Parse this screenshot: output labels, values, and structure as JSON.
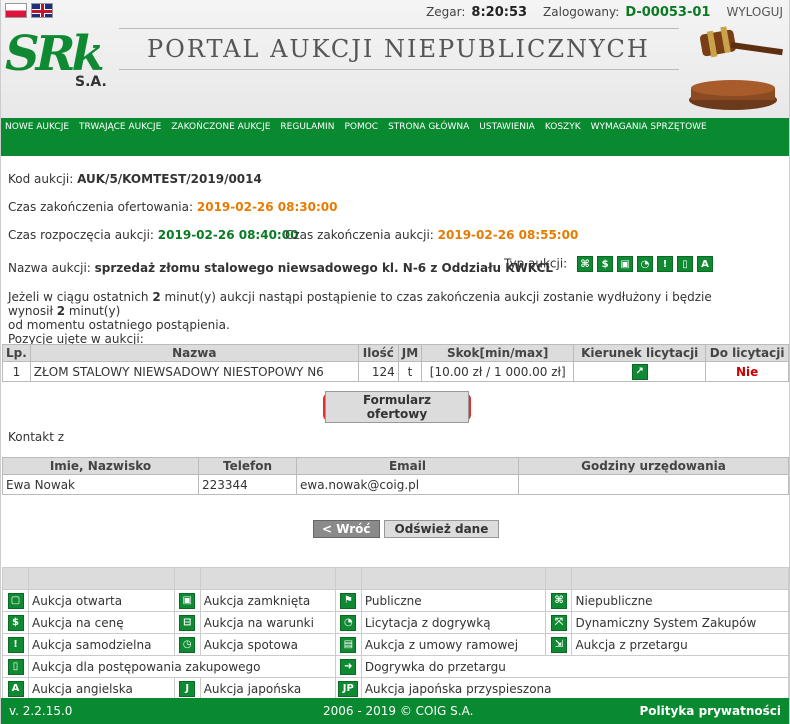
{
  "header": {
    "clock_label": "Zegar:",
    "clock_value": "8:20:53",
    "user_label": "Zalogowany:",
    "user_value": "D-00053-01",
    "logout": "WYLOGUJ",
    "logo_letters": "SRk",
    "logo_sa": "S.A.",
    "portal_title": "PORTAL AUKCJI NIEPUBLICZNYCH"
  },
  "nav": [
    "NOWE AUKCJE",
    "TRWAJĄCE AUKCJE",
    "ZAKOŃCZONE AUKCJE",
    "REGULAMIN",
    "POMOC",
    "STRONA GŁÓWNA",
    "USTAWIENIA",
    "KOSZYK",
    "WYMAGANIA SPRZĘTOWE"
  ],
  "auction": {
    "code_label": "Kod aukcji:",
    "code_value": "AUK/5/KOMTEST/2019/0014",
    "offer_end_label": "Czas zakończenia ofertowania:",
    "offer_end_value": "2019-02-26 08:30:00",
    "start_label": "Czas rozpoczęcia aukcji:",
    "start_value": "2019-02-26 08:40:00",
    "end_label": "Czas zakończenia aukcji:",
    "end_value": "2019-02-26 08:55:00",
    "name_label": "Nazwa aukcji:",
    "name_value": "sprzedaż złomu stalowego niewsadowego kl. N-6 z Oddziału KWKCL",
    "type_label": "Typ aukcji:",
    "note_line1_a": "Jeżeli w ciągu ostatnich ",
    "note_line1_b": "2",
    "note_line1_c": " minut(y) aukcji nastąpi postąpienie to czas zakończenia aukcji zostanie wydłużony i będzie wynosił ",
    "note_line1_d": "2",
    "note_line1_e": " minut(y)",
    "note_line2": "od momentu ostatniego postąpienia.",
    "note_line3": "Pozycje ujęte w aukcji:"
  },
  "items_table": {
    "headers": [
      "Lp.",
      "Nazwa",
      "Ilość",
      "JM",
      "Skok[min/max]",
      "Kierunek licytacji",
      "Do licytacji"
    ],
    "rows": [
      {
        "lp": "1",
        "name": "ZŁOM STALOWY NIEWSADOWY NIESTOPOWY N6",
        "qty": "124",
        "jm": "t",
        "step": "[10.00 zł / 1 000.00 zł]",
        "bid": "Nie"
      }
    ]
  },
  "form_button": "Formularz ofertowy",
  "contact": {
    "label": "Kontakt z",
    "headers": [
      "Imie, Nazwisko",
      "Telefon",
      "Email",
      "Godziny urzędowania"
    ],
    "rows": [
      {
        "name": "Ewa Nowak",
        "phone": "223344",
        "email": "ewa.nowak@coig.pl",
        "hours": ""
      }
    ]
  },
  "actions": {
    "back": "< Wróć",
    "refresh": "Odśwież dane"
  },
  "legend": {
    "r1": [
      "Aukcja otwarta",
      "Aukcja zamknięta",
      "Publiczne",
      "Niepubliczne"
    ],
    "r2": [
      "Aukcja na cenę",
      "Aukcja na warunki",
      "Licytacja z dogrywką",
      "Dynamiczny System Zakupów"
    ],
    "r3": [
      "Aukcja samodzielna",
      "Aukcja spotowa",
      "Aukcja z umowy ramowej",
      "Aukcja z przetargu"
    ],
    "r4": [
      "Aukcja dla postępowania zakupowego",
      "Dogrywka do przetargu"
    ],
    "r5": [
      "Aukcja angielska",
      "Aukcja japońska",
      "Aukcja japońska przyspieszona"
    ]
  },
  "footer": {
    "version": "v. 2.2.15.0",
    "copyright": "2006 - 2019 © COIG S.A.",
    "privacy": "Polityka prywatności"
  },
  "colors": {
    "brand_green": "#0a8a30",
    "accent_orange": "#e87a00",
    "accent_red": "#cc0000",
    "highlight_red": "#e03030"
  }
}
